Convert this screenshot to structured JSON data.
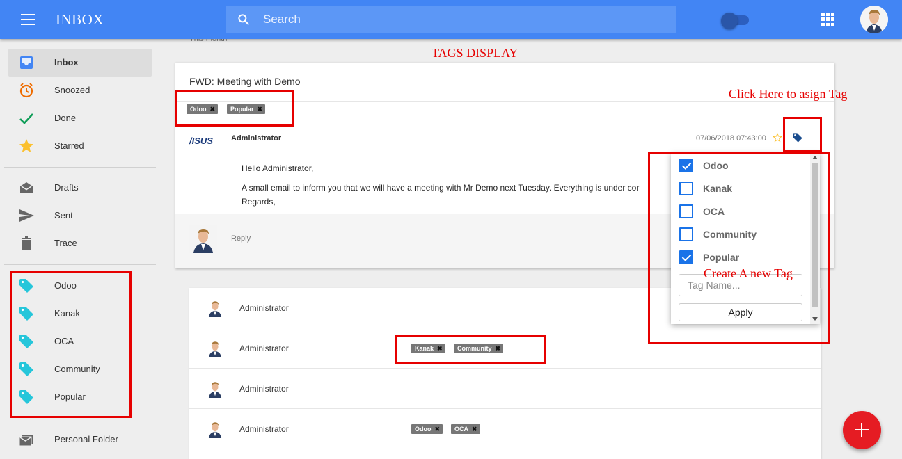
{
  "header": {
    "title": "INBOX",
    "search_placeholder": "Search"
  },
  "sidebar": {
    "items": [
      {
        "label": "Inbox",
        "icon": "inbox-icon"
      },
      {
        "label": "Snoozed",
        "icon": "clock-icon"
      },
      {
        "label": "Done",
        "icon": "check-icon"
      },
      {
        "label": "Starred",
        "icon": "star-icon"
      },
      {
        "label": "Drafts",
        "icon": "drafts-icon"
      },
      {
        "label": "Sent",
        "icon": "send-icon"
      },
      {
        "label": "Trace",
        "icon": "trash-icon"
      }
    ],
    "tags": [
      {
        "label": "Odoo",
        "icon": "tag-icon"
      },
      {
        "label": "Kanak",
        "icon": "tag-icon"
      },
      {
        "label": "OCA",
        "icon": "tag-icon"
      },
      {
        "label": "Community",
        "icon": "tag-icon"
      },
      {
        "label": "Popular",
        "icon": "tag-icon"
      }
    ],
    "folder": {
      "label": "Personal Folder",
      "icon": "folder-icon"
    }
  },
  "main": {
    "section_label": "This month",
    "message": {
      "subject": "FWD: Meeting with Demo",
      "tags": [
        "Odoo",
        "Popular"
      ],
      "logo_text": "/ISUS",
      "sender": "Administrator",
      "date": "07/06/2018 07:43:00",
      "body": [
        "Hello Administrator,",
        "A small email to inform you that we will have a meeting with Mr Demo next Tuesday. Everything is under cor",
        "Regards,"
      ],
      "reply_label": "Reply"
    },
    "list": [
      {
        "sender": "Administrator",
        "tags": []
      },
      {
        "sender": "Administrator",
        "tags": [
          "Kanak",
          "Community"
        ]
      },
      {
        "sender": "Administrator",
        "tags": []
      },
      {
        "sender": "Administrator",
        "tags": [
          "Odoo",
          "OCA"
        ]
      }
    ]
  },
  "tag_dropdown": {
    "options": [
      {
        "label": "Odoo",
        "checked": true
      },
      {
        "label": "Kanak",
        "checked": false
      },
      {
        "label": "OCA",
        "checked": false
      },
      {
        "label": "Community",
        "checked": false
      },
      {
        "label": "Popular",
        "checked": true
      }
    ],
    "input_placeholder": "Tag Name...",
    "apply_label": "Apply"
  },
  "annotations": {
    "tags_display": "TAGS DISPLAY",
    "click_here": "Click Here to asign Tag",
    "create_new": "Create A new Tag"
  },
  "colors": {
    "header": "#4285f4",
    "accent": "#1a73e8",
    "annotation_red": "#e60000",
    "fab": "#e51c23",
    "tag_icon": "#26c6da"
  }
}
